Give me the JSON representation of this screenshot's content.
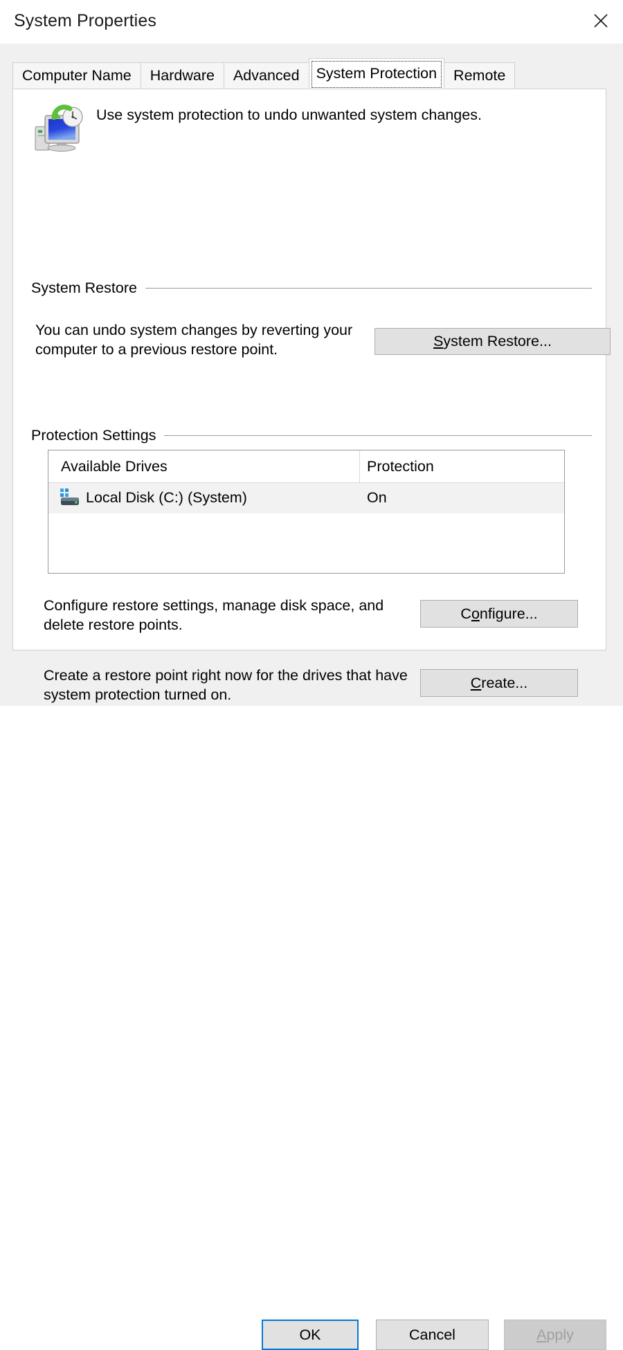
{
  "window": {
    "title": "System Properties",
    "close_icon": "close-icon"
  },
  "tabs": [
    {
      "label": "Computer Name",
      "selected": false
    },
    {
      "label": "Hardware",
      "selected": false
    },
    {
      "label": "Advanced",
      "selected": false
    },
    {
      "label": "System Protection",
      "selected": true
    },
    {
      "label": "Remote",
      "selected": false
    }
  ],
  "header": {
    "icon": "system-restore-icon",
    "description": "Use system protection to undo unwanted system changes."
  },
  "system_restore": {
    "group_label": "System Restore",
    "description": "You can undo system changes by reverting your computer to a previous restore point.",
    "button": {
      "accel": "S",
      "rest": "ystem Restore..."
    }
  },
  "protection_settings": {
    "group_label": "Protection Settings",
    "columns": [
      "Available Drives",
      "Protection"
    ],
    "rows": [
      {
        "icon": "hard-drive-icon",
        "drive": "Local Disk (C:) (System)",
        "protection": "On",
        "selected": true
      }
    ],
    "configure": {
      "description": "Configure restore settings, manage disk space, and delete restore points.",
      "button": {
        "prefix": "C",
        "accel": "o",
        "rest": "nfigure..."
      }
    },
    "create": {
      "description": "Create a restore point right now for the drives that have system protection turned on.",
      "button": {
        "accel": "C",
        "rest": "reate..."
      }
    }
  },
  "footer": {
    "ok": "OK",
    "cancel": "Cancel",
    "apply": {
      "accel": "A",
      "rest": "pply"
    },
    "apply_disabled": true
  },
  "colors": {
    "accent": "#0078d7",
    "dialog_bg": "#f0f0f0",
    "panel_bg": "#ffffff",
    "button_face": "#e1e1e1",
    "row_highlight": "#f2f2f2",
    "disabled_text": "#a0a0a0"
  }
}
